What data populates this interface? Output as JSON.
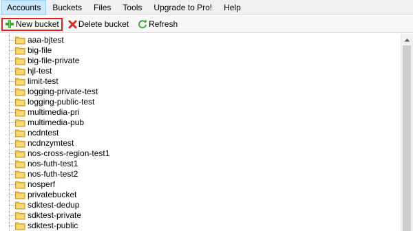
{
  "menu": {
    "items": [
      {
        "label": "Accounts"
      },
      {
        "label": "Buckets"
      },
      {
        "label": "Files"
      },
      {
        "label": "Tools"
      },
      {
        "label": "Upgrade to Pro!"
      },
      {
        "label": "Help"
      }
    ],
    "active_index": 0
  },
  "toolbar": {
    "new_bucket_label": "New bucket",
    "delete_bucket_label": "Delete bucket",
    "refresh_label": "Refresh"
  },
  "buckets": [
    "aaa-bjtest",
    "big-file",
    "big-file-private",
    "hjl-test",
    "limit-test",
    "logging-private-test",
    "logging-public-test",
    "multimedia-pri",
    "multimedia-pub",
    "ncdntest",
    "ncdnzymtest",
    "nos-cross-region-test1",
    "nos-futh-test1",
    "nos-futh-test2",
    "nosperf",
    "privatebucket",
    "sdktest-dedup",
    "sdktest-private",
    "sdktest-public"
  ],
  "colors": {
    "highlight_border": "#e0201b",
    "folder": "#f2c14e",
    "menu_active": "#cce8ff"
  }
}
